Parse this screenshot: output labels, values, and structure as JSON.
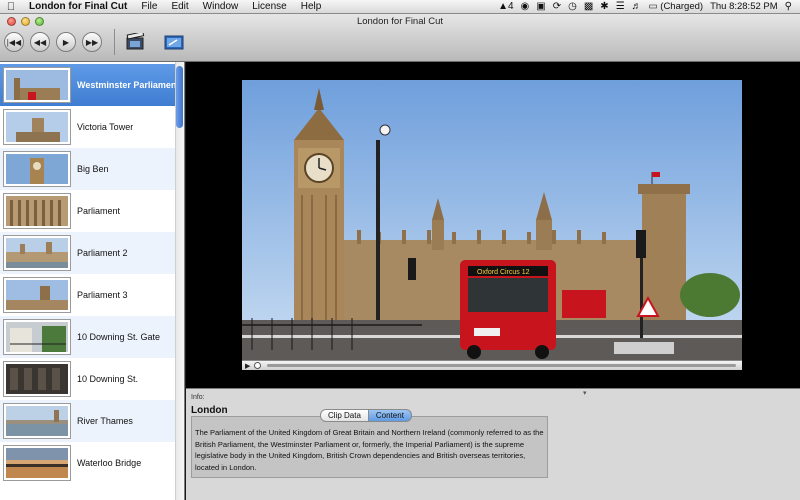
{
  "menubar": {
    "apple": "",
    "app_name": "London for Final Cut",
    "items": [
      "File",
      "Edit",
      "Window",
      "License",
      "Help"
    ],
    "status": {
      "adobe_count": "4",
      "battery": "(Charged)",
      "clock": "Thu 8:28:52 PM"
    }
  },
  "window": {
    "title": "London for Final Cut"
  },
  "toolbar": {
    "prev_glyph": "|◀◀",
    "rewind_glyph": "◀◀",
    "play_glyph": "▶",
    "forward_glyph": "▶▶"
  },
  "sidebar": {
    "items": [
      {
        "label": "Westminster Parliament",
        "selected": true
      },
      {
        "label": "Victoria Tower"
      },
      {
        "label": "Big Ben"
      },
      {
        "label": "Parliament"
      },
      {
        "label": "Parliament 2"
      },
      {
        "label": "Parliament 3"
      },
      {
        "label": "10 Downing St. Gate"
      },
      {
        "label": "10 Downing St."
      },
      {
        "label": "River Thames"
      },
      {
        "label": "Waterloo Bridge"
      }
    ]
  },
  "video": {
    "bus_label": "Oxford Circus 12"
  },
  "info": {
    "label": "Info:",
    "title": "London",
    "tabs": [
      "Clip Data",
      "Content"
    ],
    "active_tab": "Content",
    "content": "The Parliament of the United Kingdom of Great Britain and Northern Ireland (commonly referred to as the British Parliament, the Westminster Parliament or, formerly, the Imperial Parliament) is the supreme legislative body in the United Kingdom, British Crown dependencies and British overseas territories, located in London."
  },
  "colors": {
    "selection": "#4a88da",
    "sky": "#8fb6e4",
    "stone": "#a98a62",
    "bus_red": "#c8141c"
  }
}
